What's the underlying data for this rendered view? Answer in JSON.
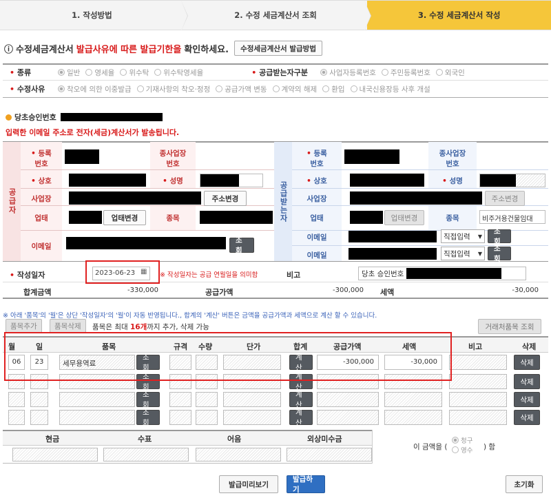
{
  "steps": [
    "1. 작성방법",
    "2. 수정 세금계산서 조회",
    "3. 수정 세금계산서 작성"
  ],
  "notice": {
    "symbol": "ⓘ",
    "prefix": "수정세금계산서",
    "highlight": "발급사유에 따른 발급기한을",
    "suffix": "확인하세요.",
    "button": "수정세금계산서 발급방법"
  },
  "type_row": {
    "label": "종류",
    "options": [
      "일반",
      "영세율",
      "위수탁",
      "위수탁영세율"
    ],
    "recipient_label": "공급받는자구분",
    "recipient_options": [
      "사업자등록번호",
      "주민등록번호",
      "외국인"
    ]
  },
  "reason_row": {
    "label": "수정사유",
    "options": [
      "착오에 의한 이중발급",
      "기재사항의 착오·정정",
      "공급가액 변동",
      "계약의 해제",
      "환입",
      "내국신용장등 사후 개설"
    ]
  },
  "approval_label": "당초승인번호",
  "email_notice": "입력한 이메일 주소로 전자(세금)계산서가 발송됩니다.",
  "supplier": {
    "side_label": "공급자",
    "reg_no": "등록\n번호",
    "branch": "종사업장\n번호",
    "name": "상호",
    "rep": "성명",
    "address": "사업장",
    "address_btn": "주소변경",
    "biz_type": "업태",
    "biz_btn": "업태변경",
    "item": "종목",
    "email": "이메일",
    "lookup": "조회"
  },
  "buyer": {
    "side_label": "공급받는자",
    "reg_no": "등록\n번호",
    "branch": "종사업장\n번호",
    "name": "상호",
    "rep": "성명",
    "address": "사업장",
    "address_btn": "주소변경",
    "biz_type": "업태",
    "biz_btn": "업태변경",
    "item": "종목",
    "item_value": "비주거용건물임대",
    "email": "이메일",
    "email_select": "직접입력",
    "lookup": "조회"
  },
  "date_row": {
    "label": "작성일자",
    "value": "2023-06-23",
    "note": "※ 작성일자는 공급 연월일을 의미함",
    "remark_label": "비고",
    "remark_value": "당초 승인번호"
  },
  "totals": {
    "total_label": "합계금액",
    "total": "-330,000",
    "supply_label": "공급가액",
    "supply": "-300,000",
    "tax_label": "세액",
    "tax": "-30,000"
  },
  "items_notice": "※ 아래 '품목'의 '월'은 상단 '작성일자'의 '월'이 자동 반영됩니다., 합계의 '계산' 버튼은 금액을 공급가액과 세액으로 계산 할 수 있습니다.",
  "items_toolbar": {
    "add": "품목추가",
    "delete": "품목삭제",
    "limit_prefix": "품목은 최대",
    "limit_count": "16개",
    "limit_suffix": "까지 추가, 삭제 가능",
    "trade_lookup": "거래처품목 조회"
  },
  "items_headers": [
    "월",
    "일",
    "품목",
    "규격",
    "수량",
    "단가",
    "합계",
    "공급가액",
    "세액",
    "비고",
    "삭제"
  ],
  "items_rows": [
    {
      "month": "06",
      "day": "23",
      "item": "세무용역료",
      "supply": "-300,000",
      "tax": "-30,000"
    },
    {
      "month": "",
      "day": "",
      "item": "",
      "supply": "",
      "tax": ""
    },
    {
      "month": "",
      "day": "",
      "item": "",
      "supply": "",
      "tax": ""
    },
    {
      "month": "",
      "day": "",
      "item": "",
      "supply": "",
      "tax": ""
    }
  ],
  "row_buttons": {
    "lookup": "조회",
    "calc": "계산",
    "delete": "삭제"
  },
  "payment": {
    "headers": [
      "현금",
      "수표",
      "어음",
      "외상미수금"
    ],
    "amount_prefix": "이 금액을 (",
    "opt1": "청구",
    "opt2": "영수",
    "amount_suffix": ") 함"
  },
  "footer": {
    "preview": "발급미리보기",
    "issue": "발급하기",
    "reset": "초기화"
  },
  "colors": {
    "accent": "#f5c63a",
    "red": "#d81a1a",
    "highlight_box": "#e02020",
    "blue_btn": "#2f6fc2"
  }
}
